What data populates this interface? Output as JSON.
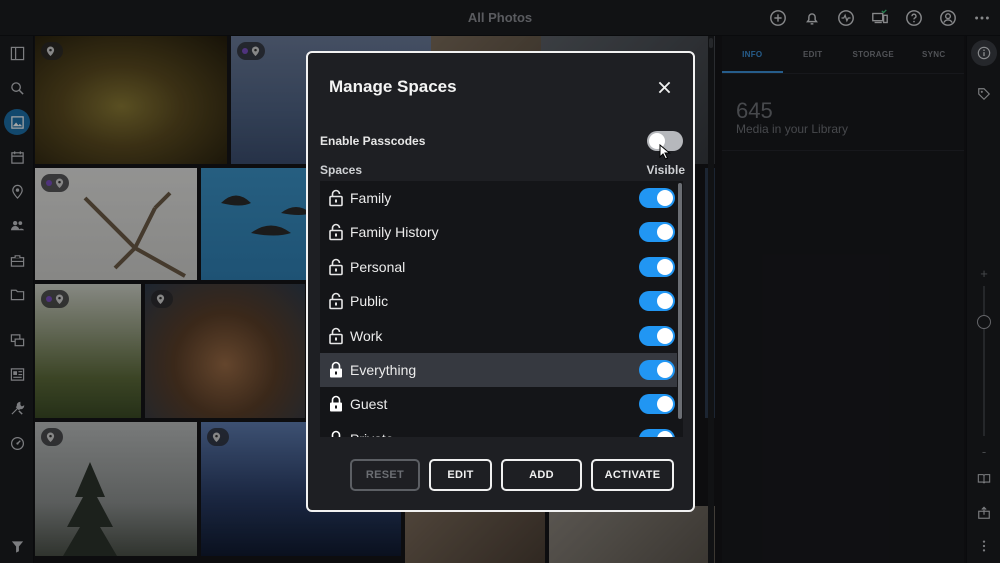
{
  "app": {
    "title": "All Photos"
  },
  "colors": {
    "accent": "#2196f3",
    "toggle_off": "#b6b8bc",
    "modal_bg": "#1e1f23"
  },
  "top_icons": [
    "add-circle-icon",
    "bell-icon",
    "activity-icon",
    "devices-icon",
    "help-icon",
    "account-icon",
    "more-icon"
  ],
  "left_nav": [
    "sidebar-toggle-icon",
    "search-icon",
    "photos-icon",
    "calendar-icon",
    "places-icon",
    "people-icon",
    "briefcase-icon",
    "folder-icon",
    "stack-icon",
    "gallery-icon",
    "tools-icon",
    "dashboard-icon",
    "filter-icon"
  ],
  "right_panel": {
    "tabs": [
      {
        "label": "INFO",
        "active": true
      },
      {
        "label": "EDIT",
        "active": false
      },
      {
        "label": "STORAGE",
        "active": false
      },
      {
        "label": "SYNC",
        "active": false
      }
    ],
    "media_count": "645",
    "media_label": "Media in your Library"
  },
  "right_rail": {
    "zoom_plus": "+",
    "zoom_minus": "-",
    "zoom_level": 0.2
  },
  "modal": {
    "title": "Manage Spaces",
    "enable_passcodes_label": "Enable Passcodes",
    "enable_passcodes_on": false,
    "spaces_header": "Spaces",
    "visible_header": "Visible",
    "spaces": [
      {
        "name": "Family",
        "locked": false,
        "visible": true,
        "selected": false
      },
      {
        "name": "Family History",
        "locked": false,
        "visible": true,
        "selected": false
      },
      {
        "name": "Personal",
        "locked": false,
        "visible": true,
        "selected": false
      },
      {
        "name": "Public",
        "locked": false,
        "visible": true,
        "selected": false
      },
      {
        "name": "Work",
        "locked": false,
        "visible": true,
        "selected": false
      },
      {
        "name": "Everything",
        "locked": true,
        "visible": true,
        "selected": true
      },
      {
        "name": "Guest",
        "locked": true,
        "visible": true,
        "selected": false
      },
      {
        "name": "Private",
        "locked": true,
        "visible": true,
        "selected": false
      }
    ],
    "buttons": {
      "reset": "RESET",
      "edit": "EDIT",
      "add": "ADD",
      "activate": "ACTIVATE"
    }
  }
}
